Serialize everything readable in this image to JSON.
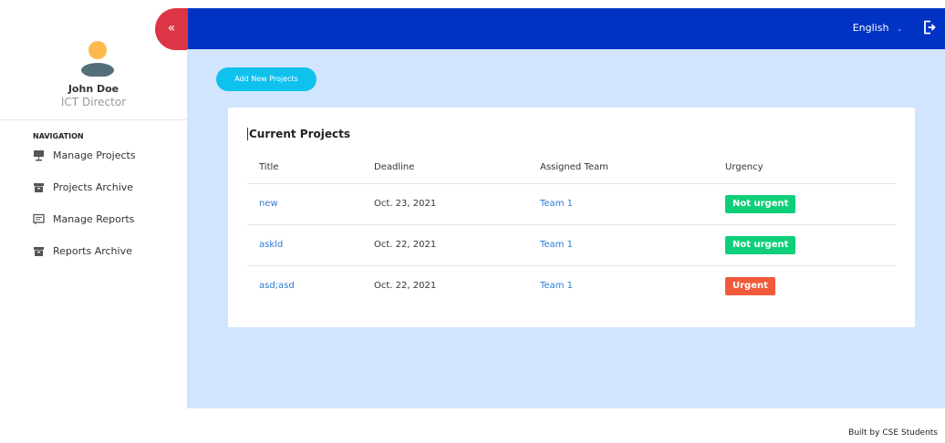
{
  "sidebar": {
    "collapse_glyph": "«",
    "user": {
      "name": "John Doe",
      "role": "ICT Director"
    },
    "nav_heading": "NAVIGATION",
    "items": [
      {
        "label": "Manage Projects",
        "icon": "projector-screen-icon"
      },
      {
        "label": "Projects Archive",
        "icon": "archive-box-icon"
      },
      {
        "label": "Manage Reports",
        "icon": "message-report-icon"
      },
      {
        "label": "Reports Archive",
        "icon": "archive-box-icon"
      }
    ]
  },
  "topbar": {
    "language": "English",
    "chevron": "⌄",
    "colors": {
      "bar": "#0033c4"
    }
  },
  "main": {
    "add_button": "Add New Projects",
    "card": {
      "title": "Current Projects",
      "columns": [
        "Title",
        "Deadline",
        "Assigned Team",
        "Urgency"
      ],
      "rows": [
        {
          "title": "new",
          "deadline": "Oct. 23, 2021",
          "team": "Team 1",
          "urgency": "Not urgent",
          "urgency_color": "#0fcf7a"
        },
        {
          "title": "askld",
          "deadline": "Oct. 22, 2021",
          "team": "Team 1",
          "urgency": "Not urgent",
          "urgency_color": "#0fcf7a"
        },
        {
          "title": "asd;asd",
          "deadline": "Oct. 22, 2021",
          "team": "Team 1",
          "urgency": "Urgent",
          "urgency_color": "#f05a3a"
        }
      ]
    }
  },
  "footer": {
    "text": "Built by CSE Students"
  }
}
